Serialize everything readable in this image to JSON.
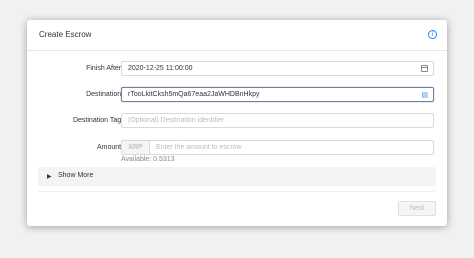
{
  "header": {
    "title": "Create Escrow",
    "info_icon": "info-icon"
  },
  "form": {
    "finish_after": {
      "label": "Finish After :",
      "value": "2020-12-25 11:00:00",
      "icon": "calendar-icon"
    },
    "destination": {
      "label": "Destination :",
      "value": "rTooLkitCksh5mQa67eaa2JaWHDBnHkpy",
      "icon": "address-book-icon"
    },
    "destination_tag": {
      "label": "Destination Tag :",
      "placeholder": "(Optional) Destination identifier"
    },
    "amount": {
      "label": "Amount :",
      "currency": "XRP",
      "placeholder": "Enter the amount to escrow",
      "available": "Available: 0.5313"
    }
  },
  "show_more": {
    "label": "Show More",
    "icon": "caret-right-icon"
  },
  "footer": {
    "next_label": "Next"
  },
  "colors": {
    "accent": "#3a8ee6",
    "info": "#2f80ed"
  }
}
